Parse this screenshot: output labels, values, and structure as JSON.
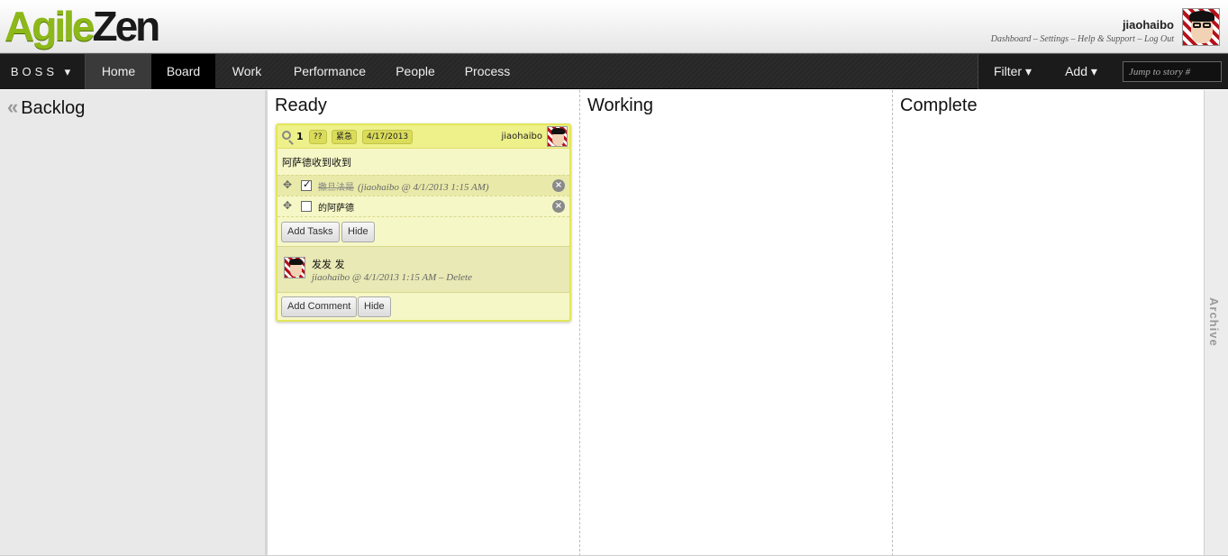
{
  "header": {
    "logo_part1": "Agile",
    "logo_part2": "Zen",
    "username": "jiaohaibo",
    "links": {
      "dashboard": "Dashboard",
      "settings": "Settings",
      "help": "Help & Support",
      "logout": "Log Out",
      "separator": " – "
    }
  },
  "nav": {
    "project": "BOSS ▾",
    "items": [
      "Home",
      "Board",
      "Work",
      "Performance",
      "People",
      "Process"
    ],
    "active": "Board",
    "filter": "Filter ▾",
    "add": "Add ▾",
    "jump_placeholder": "Jump to story #"
  },
  "board": {
    "backlog": {
      "chevron": "«",
      "title": "Backlog"
    },
    "columns": [
      "Ready",
      "Working",
      "Complete"
    ],
    "archive": "Archive"
  },
  "card": {
    "number": "1",
    "tags": [
      "??",
      "紧急",
      "4/17/2013"
    ],
    "owner": "jiaohaibo",
    "text": "阿萨德收到收到",
    "tasks": [
      {
        "label": "撒旦法是",
        "meta": "(jiaohaibo @ 4/1/2013 1:15 AM)",
        "done": true
      },
      {
        "label": "的阿萨德",
        "meta": "",
        "done": false
      }
    ],
    "add_tasks_label": "Add Tasks",
    "hide_tasks_label": "Hide",
    "comment": {
      "text": "发发 发",
      "meta": "jiaohaibo @ 4/1/2013 1:15 AM",
      "separator": " – ",
      "delete_label": "Delete"
    },
    "add_comment_label": "Add Comment",
    "hide_comments_label": "Hide"
  },
  "colors": {
    "brand_green": "#8db819",
    "card_bg": "#f6f7c6",
    "card_border": "#e3e65a",
    "nav_bg": "#2a2a2a"
  },
  "icons": [
    "magnifier-icon",
    "move-icon",
    "remove-icon",
    "double-chevron-left-icon",
    "avatar"
  ]
}
